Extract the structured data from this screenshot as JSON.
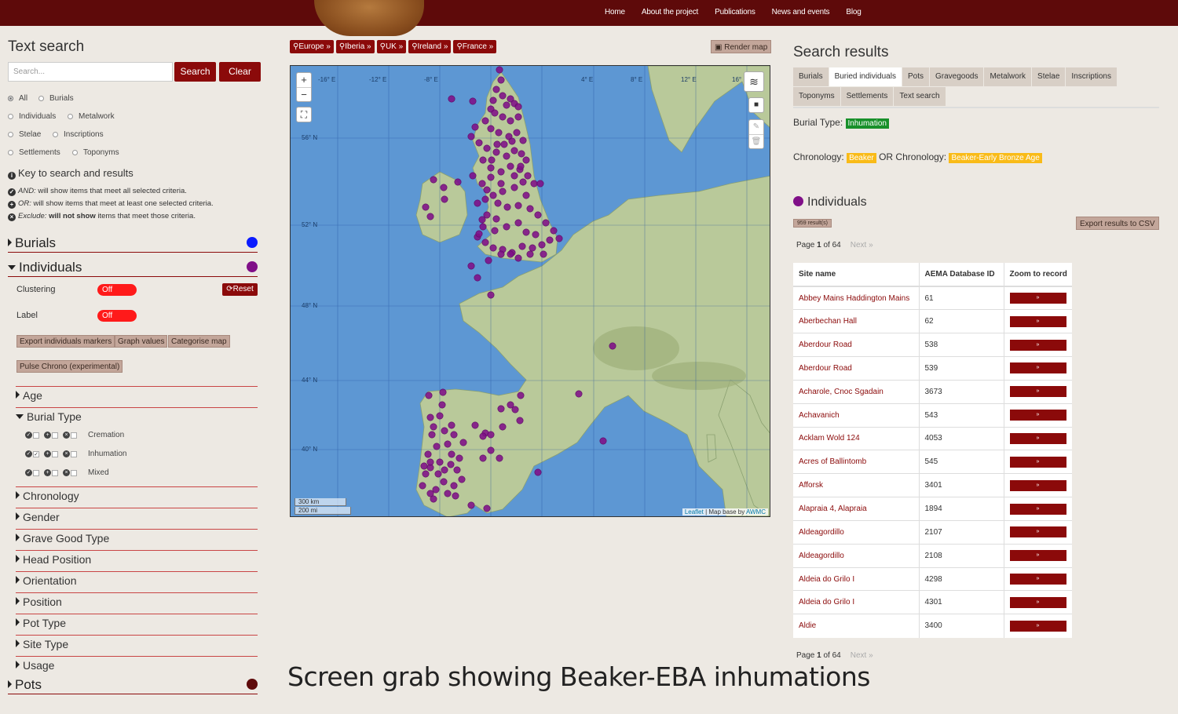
{
  "nav": {
    "items": [
      "Home",
      "About the project",
      "Publications",
      "News and events",
      "Blog"
    ]
  },
  "text_search": {
    "title": "Text search",
    "placeholder": "Search...",
    "search_label": "Search",
    "clear_label": "Clear",
    "options": [
      "All",
      "Burials",
      "Individuals",
      "Metalwork",
      "Stelae",
      "Inscriptions",
      "Settlements",
      "Toponyms"
    ],
    "selected": "All"
  },
  "key": {
    "title": "Key to search and results",
    "and_term": "AND:",
    "and_text": "will show items that meet all selected criteria.",
    "or_term": "OR:",
    "or_text": "will show items that meet at least one selected criteria.",
    "exclude_term": "Exclude:",
    "exclude_bold": "will not show",
    "exclude_text": "items that meet those criteria."
  },
  "sections": {
    "burials": {
      "label": "Burials",
      "color": "#0b1bff"
    },
    "individuals": {
      "label": "Individuals",
      "color": "#800f88"
    },
    "pots": {
      "label": "Pots",
      "color": "#5e0a0a"
    }
  },
  "controls": {
    "clustering_label": "Clustering",
    "clustering_state": "Off",
    "label_label": "Label",
    "label_state": "Off",
    "reset_label": "Reset",
    "buttons": [
      "Export individuals markers",
      "Graph values",
      "Categorise map"
    ],
    "pulse_label": "Pulse Chrono (experimental)"
  },
  "filters": {
    "age": "Age",
    "burial_type": "Burial Type",
    "burial_type_options": [
      {
        "label": "Cremation",
        "checked": false
      },
      {
        "label": "Inhumation",
        "checked": true
      },
      {
        "label": "Mixed",
        "checked": false
      }
    ],
    "rest": [
      "Chronology",
      "Gender",
      "Grave Good Type",
      "Head Position",
      "Orientation",
      "Position",
      "Pot Type",
      "Site Type",
      "Usage"
    ]
  },
  "map": {
    "regions": [
      "Europe",
      "Iberia",
      "UK",
      "Ireland",
      "France"
    ],
    "render_label": "Render map",
    "zoom_in": "+",
    "zoom_out": "−",
    "scale_km": "300 km",
    "scale_mi": "200 mi",
    "attrib_link1": "Leaflet",
    "attrib_text": " | Map base by ",
    "attrib_link2": "AWMC",
    "lat_labels": [
      "56° N",
      "52° N",
      "48° N",
      "44° N",
      "40° N"
    ],
    "lon_labels": [
      "-16° E",
      "-12° E",
      "-8° E",
      "4° E",
      "8° E",
      "12° E",
      "16° E"
    ],
    "marker_color": "#800f88"
  },
  "results": {
    "title": "Search results",
    "tabs_row1": [
      "Burials",
      "Buried individuals",
      "Pots",
      "Gravegoods",
      "Metalwork",
      "Stelae",
      "Inscriptions"
    ],
    "tabs_row2": [
      "Toponyms",
      "Settlements",
      "Text search"
    ],
    "active_tab": "Buried individuals",
    "burial_type_label": "Burial Type:",
    "burial_type_value": "Inhumation",
    "chronology_label": "Chronology:",
    "chronology_value1": "Beaker",
    "or_chronology": "OR Chronology:",
    "chronology_value2": "Beaker-Early Bronze Age",
    "individuals_heading": "Individuals",
    "count": "959 result(s)",
    "export_label": "Export results to CSV",
    "page_label": "Page",
    "page_num": "1",
    "page_of": "of 64",
    "next_label": "Next »",
    "columns": [
      "Site name",
      "AEMA Database ID",
      "Zoom to record"
    ],
    "zoom_btn": "»",
    "rows": [
      {
        "site": "Abbey Mains Haddington Mains",
        "id": "61"
      },
      {
        "site": "Aberbechan Hall",
        "id": "62"
      },
      {
        "site": "Aberdour Road",
        "id": "538"
      },
      {
        "site": "Aberdour Road",
        "id": "539"
      },
      {
        "site": "Acharole, Cnoc Sgadain",
        "id": "3673"
      },
      {
        "site": "Achavanich",
        "id": "543"
      },
      {
        "site": "Acklam Wold 124",
        "id": "4053"
      },
      {
        "site": "Acres of Ballintomb",
        "id": "545"
      },
      {
        "site": "Afforsk",
        "id": "3401"
      },
      {
        "site": "Alapraia 4, Alapraia",
        "id": "1894"
      },
      {
        "site": "Aldeagordillo",
        "id": "2107"
      },
      {
        "site": "Aldeagordillo",
        "id": "2108"
      },
      {
        "site": "Aldeia do Grilo I",
        "id": "4298"
      },
      {
        "site": "Aldeia do Grilo I",
        "id": "4301"
      },
      {
        "site": "Aldie",
        "id": "3400"
      }
    ]
  },
  "caption": "Screen grab showing Beaker-EBA inhumations"
}
